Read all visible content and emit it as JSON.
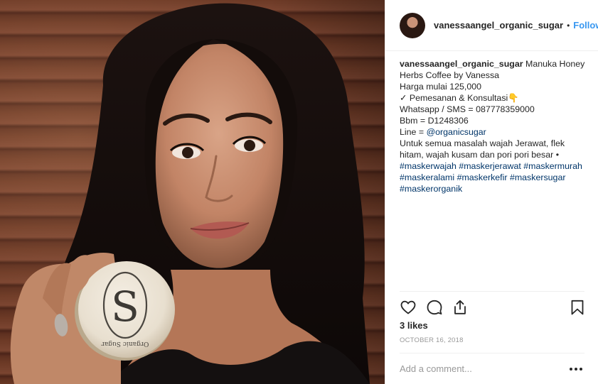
{
  "post": {
    "username": "vanessaangel_organic_sugar",
    "follow_label": "Follow",
    "separator": "•",
    "caption": {
      "username": "vanessaangel_organic_sugar",
      "line1_text": "Manuka Honey",
      "line2": "Herbs Coffee by Vanessa",
      "line3": "Harga mulai 125,000",
      "line4": "✓ Pemesanan & Konsultasi👇",
      "line5": "Whatsapp / SMS = 087778359000",
      "line6": "Bbm = D1248306",
      "line7_prefix": "Line = ",
      "line7_link": "@organicsugar",
      "line8": "Untuk semua masalah wajah Jerawat, flek",
      "line9": "hitam, wajah kusam dan pori pori besar •",
      "hashtags_row1": [
        "#maskerwajah",
        "#maskerjerawat",
        "#maskermurah"
      ],
      "hashtags_row2": [
        "#maskeralami",
        "#maskerkefir",
        "#maskersugar"
      ],
      "hashtags_row3": [
        "#maskerorganik"
      ]
    },
    "likes": "3 likes",
    "date": "OCTOBER 16, 2018",
    "comment_placeholder": "Add a comment...",
    "more_label": "•••"
  },
  "product": {
    "logo_letter": "S",
    "brand_text": "Organic Sugar"
  },
  "icons": {
    "like": "heart-icon",
    "comment": "comment-icon",
    "share": "share-icon",
    "save": "bookmark-icon"
  },
  "colors": {
    "follow_blue": "#3897f0",
    "link_blue": "#003569",
    "muted_gray": "#999999",
    "text_dark": "#262626"
  }
}
